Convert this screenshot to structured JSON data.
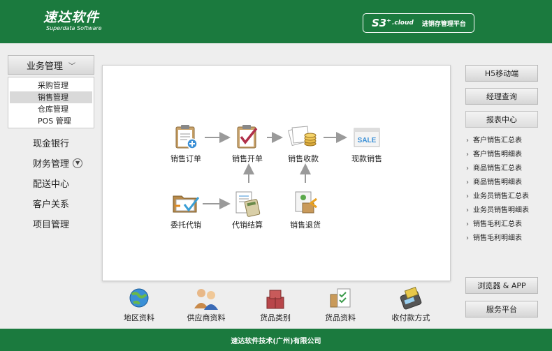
{
  "header": {
    "logo_cn": "速达软件",
    "logo_en": "Superdata Software",
    "product_s3": "S3",
    "product_plus": "+",
    "product_cloud": ".cloud",
    "platform_name": "进销存管理平台"
  },
  "nav": {
    "current": "业务管理",
    "submenu": [
      {
        "label": "采购管理",
        "active": false
      },
      {
        "label": "销售管理",
        "active": true
      },
      {
        "label": "仓库管理",
        "active": false
      },
      {
        "label": "POS 管理",
        "active": false
      }
    ],
    "items": [
      "现金银行",
      "财务管理",
      "配送中心",
      "客户关系",
      "项目管理"
    ]
  },
  "flow": {
    "sales_order": "销售订单",
    "sales_invoice": "销售开单",
    "sales_receipt": "销售收款",
    "cash_sale": "现款销售",
    "consignment": "委托代销",
    "consignment_settle": "代销结算",
    "sales_return": "销售退货"
  },
  "quick": {
    "region": "地区资料",
    "supplier": "供应商资料",
    "goods_category": "货品类别",
    "goods": "货品资料",
    "payment": "收付款方式"
  },
  "right": {
    "h5": "H5移动端",
    "manager": "经理查询",
    "report_center": "报表中心",
    "reports": [
      "客户销售汇总表",
      "客户销售明细表",
      "商品销售汇总表",
      "商品销售明细表",
      "业务员销售汇总表",
      "业务员销售明细表",
      "销售毛利汇总表",
      "销售毛利明细表"
    ],
    "browser_app": "浏览器 & APP",
    "service": "服务平台"
  },
  "footer": {
    "company": "速达软件技术(广州)有限公司"
  },
  "colors": {
    "brand_green": "#1b7a3e"
  }
}
